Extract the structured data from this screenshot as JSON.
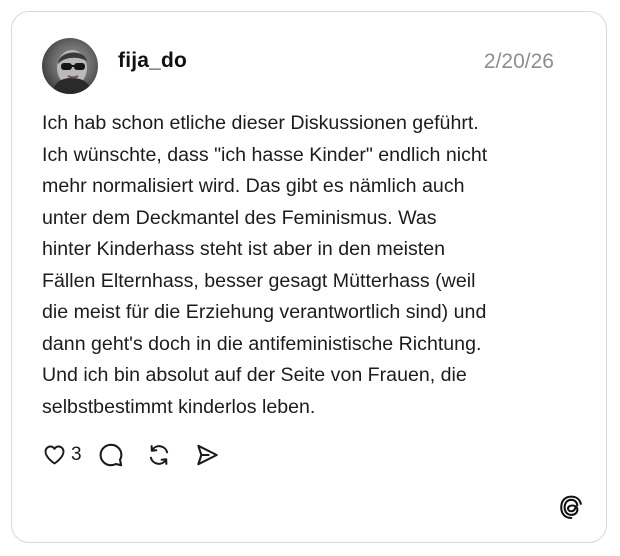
{
  "post": {
    "author": {
      "username": "fija_do"
    },
    "date": "2/20/26",
    "text_lines": [
      "Ich hab schon etliche dieser Diskussionen geführt.",
      "Ich wünschte, dass \"ich hasse Kinder\" endlich nicht",
      "mehr normalisiert wird. Das gibt es nämlich auch",
      "unter dem Deckmantel des Feminismus. Was",
      "hinter Kinderhass steht ist aber in den meisten",
      "Fällen Elternhass, besser gesagt Mütterhass (weil",
      "die meist für die Erziehung verantwortlich sind) und",
      "dann geht's doch in die antifeministische Richtung.",
      "Und ich bin absolut auf der Seite von Frauen, die",
      "selbstbestimmt kinderlos leben."
    ],
    "actions": {
      "like_count": "3",
      "like_icon": "heart-icon",
      "reply_icon": "comment-icon",
      "repost_icon": "repost-icon",
      "share_icon": "send-icon"
    }
  },
  "branding": {
    "logo_icon": "threads-logo-icon"
  },
  "colors": {
    "text": "#1c1c1c",
    "muted": "#8e8e8e",
    "border": "#d9d9d9",
    "background": "#ffffff"
  }
}
